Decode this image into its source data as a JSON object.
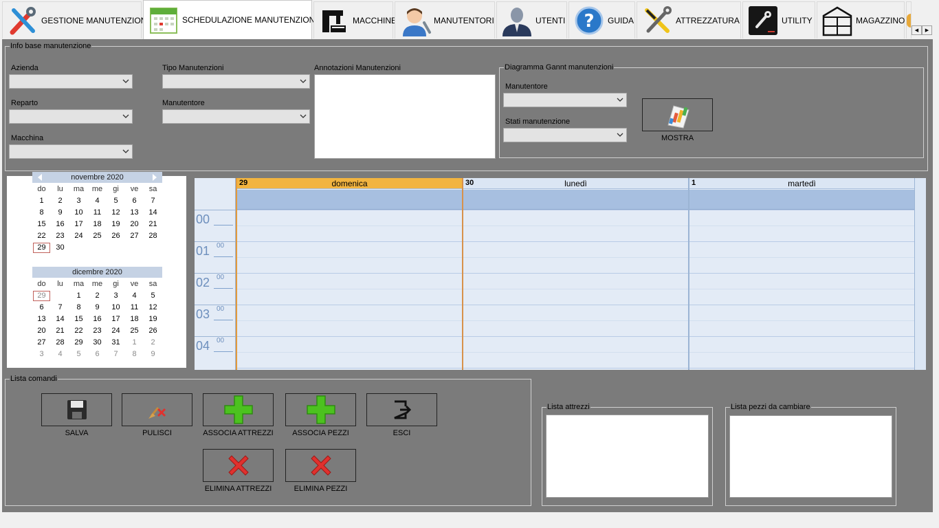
{
  "tabs": [
    {
      "label": "GESTIONE MANUTENZIONI",
      "icon": "tools-icon",
      "active": false
    },
    {
      "label": "SCHEDULAZIONE MANUTENZIONI",
      "icon": "calendar-icon",
      "active": true
    },
    {
      "label": "MACCHINE",
      "icon": "machine-icon",
      "active": false
    },
    {
      "label": "MANUTENTORI",
      "icon": "technician-icon",
      "active": false
    },
    {
      "label": "UTENTI",
      "icon": "user-icon",
      "active": false
    },
    {
      "label": "GUIDA",
      "icon": "help-icon",
      "active": false
    },
    {
      "label": "ATTREZZATURA",
      "icon": "wrench-screwdriver-icon",
      "active": false
    },
    {
      "label": "UTILITY",
      "icon": "utility-icon",
      "active": false
    },
    {
      "label": "MAGAZZINO",
      "icon": "warehouse-icon",
      "active": false
    }
  ],
  "info": {
    "legend": "Info base manutenzione",
    "azienda_label": "Azienda",
    "reparto_label": "Reparto",
    "macchina_label": "Macchina",
    "tipo_label": "Tipo Manutenzioni",
    "manutentore_label": "Manutentore",
    "annotazioni_label": "Annotazioni Manutenzioni",
    "azienda_value": "",
    "reparto_value": "",
    "macchina_value": "",
    "tipo_value": "",
    "manutentore_value": "",
    "annotazioni_value": ""
  },
  "gantt": {
    "legend": "Diagramma Gannt manutenzioni",
    "manutentore_label": "Manutentore",
    "stati_label": "Stati manutenzione",
    "manutentore_value": "",
    "stati_value": "",
    "mostra_label": "MOSTRA"
  },
  "calendar": {
    "dow": [
      "do",
      "lu",
      "ma",
      "me",
      "gi",
      "ve",
      "sa"
    ],
    "months": [
      {
        "title": "novembre 2020",
        "weeks": [
          [
            "1",
            "2",
            "3",
            "4",
            "5",
            "6",
            "7"
          ],
          [
            "8",
            "9",
            "10",
            "11",
            "12",
            "13",
            "14"
          ],
          [
            "15",
            "16",
            "17",
            "18",
            "19",
            "20",
            "21"
          ],
          [
            "22",
            "23",
            "24",
            "25",
            "26",
            "27",
            "28"
          ],
          [
            "29",
            "30",
            "",
            "",
            "",
            "",
            ""
          ]
        ]
      },
      {
        "title": "dicembre 2020",
        "weeks": [
          [
            "29",
            "",
            "1",
            "2",
            "3",
            "4",
            "5"
          ],
          [
            "6",
            "7",
            "8",
            "9",
            "10",
            "11",
            "12"
          ],
          [
            "13",
            "14",
            "15",
            "16",
            "17",
            "18",
            "19"
          ],
          [
            "20",
            "21",
            "22",
            "23",
            "24",
            "25",
            "26"
          ],
          [
            "27",
            "28",
            "29",
            "30",
            "31",
            "1",
            "2"
          ],
          [
            "3",
            "4",
            "5",
            "6",
            "7",
            "8",
            "9"
          ]
        ]
      }
    ],
    "today": "29"
  },
  "scheduler": {
    "days": [
      {
        "num": "29",
        "name": "domenica",
        "accent": "#f2b440"
      },
      {
        "num": "30",
        "name": "lunedì",
        "accent": "#dbe6f4"
      },
      {
        "num": "1",
        "name": "martedì",
        "accent": "#dbe6f4"
      }
    ],
    "hours": [
      "00",
      "01",
      "02",
      "03",
      "04"
    ],
    "minute_label": "00"
  },
  "commands": {
    "legend": "Lista comandi",
    "salva": "SALVA",
    "pulisci": "PULISCI",
    "associa_attrezzi": "ASSOCIA ATTREZZI",
    "associa_pezzi": "ASSOCIA PEZZI",
    "esci": "ESCI",
    "elimina_attrezzi": "ELIMINA ATTREZZI",
    "elimina_pezzi": "ELIMINA PEZZI"
  },
  "lists": {
    "attrezzi_legend": "Lista attrezzi",
    "pezzi_legend": "Lista pezzi da cambiare"
  },
  "colors": {
    "panel": "#7b7b7b",
    "today_border": "#c0605a",
    "scheduler_bg": "#e3ebf6",
    "allday": "#a7bfe0",
    "green_plus": "#4cc21f",
    "red_x": "#e0312e"
  }
}
